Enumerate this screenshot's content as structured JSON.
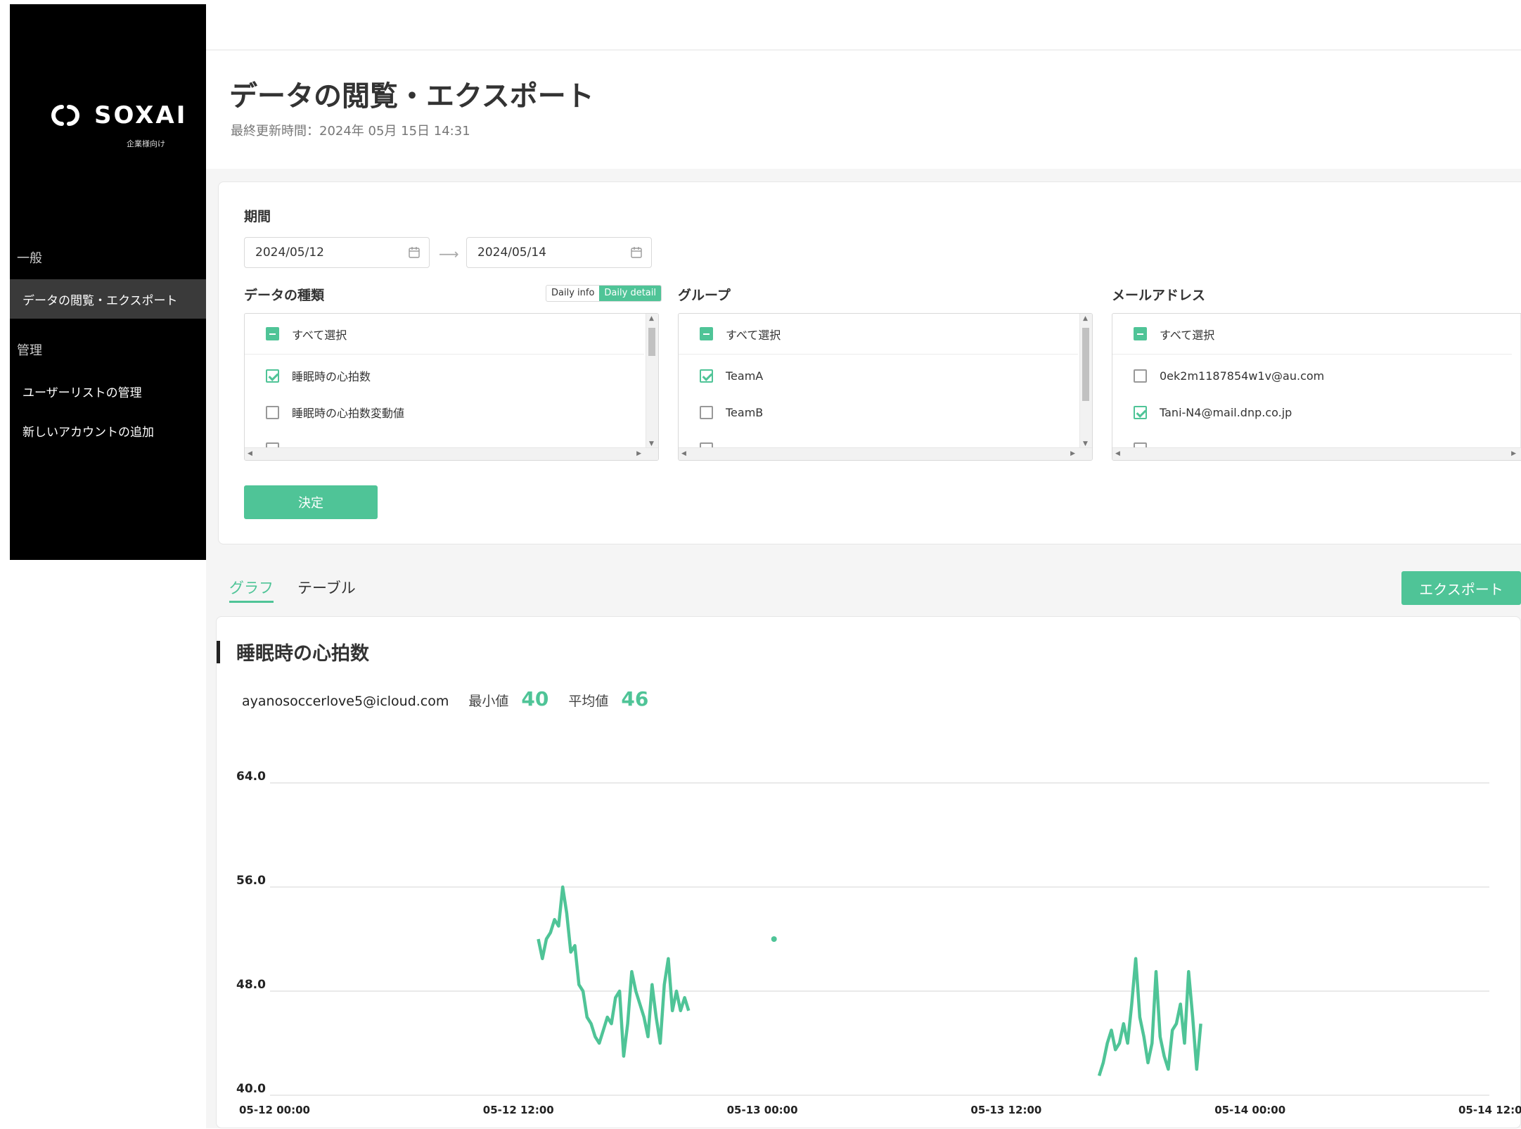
{
  "sidebar": {
    "brand": "SOXAI",
    "brand_sub": "企業様向け",
    "section_general": "一般",
    "item_view_export": "データの閲覧・エクスポート",
    "section_admin": "管理",
    "item_user_list": "ユーザーリストの管理",
    "item_add_account": "新しいアカウントの追加"
  },
  "header": {
    "title": "データの閲覧・エクスポート",
    "updated": "最終更新時間：2024年 05月 15日 14:31"
  },
  "filter": {
    "period_label": "期間",
    "date_from": "2024/05/12",
    "date_to": "2024/05/14",
    "arrow": "⟶",
    "data_type_label": "データの種類",
    "toggle_daily_info": "Daily info",
    "toggle_daily_detail": "Daily detail",
    "group_label": "グループ",
    "email_label": "メールアドレス",
    "select_all": "すべて選択",
    "data_types": [
      {
        "label": "睡眠時の心拍数",
        "checked": true
      },
      {
        "label": "睡眠時の心拍数変動値",
        "checked": false
      }
    ],
    "groups": [
      {
        "label": "TeamA",
        "checked": true
      },
      {
        "label": "TeamB",
        "checked": false
      }
    ],
    "emails": [
      {
        "label": "0ek2m1187854w1v@au.com",
        "checked": false
      },
      {
        "label": "Tani-N4@mail.dnp.co.jp",
        "checked": true
      }
    ],
    "submit": "決定"
  },
  "tabs": {
    "graph": "グラフ",
    "table": "テーブル",
    "export": "エクスポート"
  },
  "chart": {
    "title": "睡眠時の心拍数",
    "user_email": "ayanosoccerlove5@icloud.com",
    "min_label": "最小値",
    "min_value": "40",
    "avg_label": "平均値",
    "avg_value": "46"
  },
  "colors": {
    "accent": "#4fc497",
    "sidebar_bg": "#000000"
  },
  "chart_data": {
    "type": "line",
    "title": "睡眠時の心拍数",
    "ylim": [
      40,
      64
    ],
    "yticks": [
      "64.0",
      "56.0",
      "48.0",
      "40.0"
    ],
    "xticks": [
      "05-12 00:00",
      "05-12 12:00",
      "05-13 00:00",
      "05-13 12:00",
      "05-14 00:00",
      "05-14 12:00"
    ],
    "x_range_hours": [
      0,
      60
    ],
    "series": [
      {
        "segments": [
          {
            "x": [
              13.2,
              13.4,
              13.6,
              13.8,
              14.0,
              14.2,
              14.4,
              14.6,
              14.8,
              15.0,
              15.2,
              15.4,
              15.6,
              15.8,
              16.0,
              16.2,
              16.4,
              16.6,
              16.8,
              17.0,
              17.2,
              17.4,
              17.6,
              17.8,
              18.0,
              18.2,
              18.4,
              18.6,
              18.8,
              19.0,
              19.2,
              19.4,
              19.6,
              19.8,
              20.0,
              20.2,
              20.4,
              20.6
            ],
            "y": [
              52.0,
              50.5,
              52.0,
              52.5,
              53.5,
              53.0,
              56.0,
              54.0,
              51.0,
              51.5,
              48.5,
              48.0,
              46.0,
              45.5,
              44.5,
              44.0,
              45.0,
              46.0,
              45.5,
              47.5,
              48.0,
              43.0,
              45.5,
              49.5,
              48.0,
              47.0,
              46.0,
              44.5,
              48.5,
              46.0,
              44.0,
              48.5,
              50.5,
              46.5,
              48.0,
              46.5,
              47.5,
              46.5
            ]
          }
        ],
        "points": [
          {
            "x": 24.8,
            "y": 52.0
          }
        ]
      },
      {
        "segments": [
          {
            "x": [
              40.8,
              41.0,
              41.2,
              41.4,
              41.6,
              41.8,
              42.0,
              42.2,
              42.4,
              42.6,
              42.8,
              43.0,
              43.2,
              43.4,
              43.6,
              43.8,
              44.0,
              44.2,
              44.4,
              44.6,
              44.8,
              45.0,
              45.2,
              45.4,
              45.6,
              45.8
            ],
            "y": [
              41.5,
              42.5,
              44.0,
              45.0,
              43.5,
              44.0,
              45.5,
              44.0,
              47.0,
              50.5,
              46.0,
              44.5,
              42.5,
              44.0,
              49.5,
              44.5,
              43.0,
              42.0,
              45.0,
              45.5,
              47.0,
              44.0,
              49.5,
              46.0,
              42.0,
              45.5
            ]
          }
        ],
        "points": []
      }
    ]
  }
}
